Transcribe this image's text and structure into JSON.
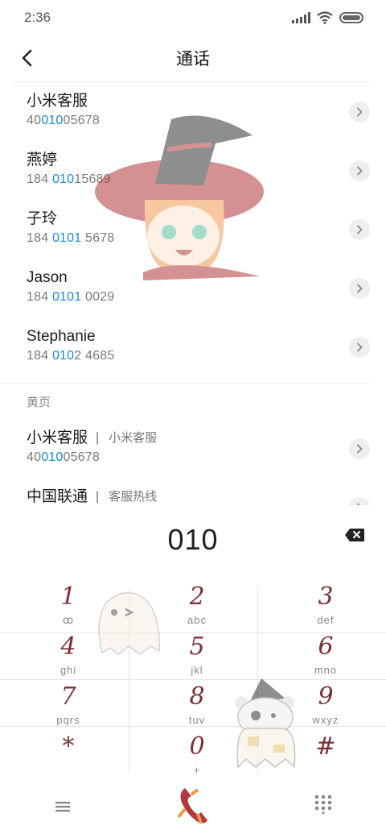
{
  "status_bar": {
    "time": "2:36"
  },
  "header": {
    "title": "通话"
  },
  "contacts": [
    {
      "name": "小米客服",
      "number_parts": [
        "40",
        "010",
        "05678"
      ]
    },
    {
      "name": "燕婷",
      "number_parts": [
        "184 ",
        "010",
        "15689"
      ]
    },
    {
      "name": "子玲",
      "number_parts": [
        "184 ",
        "0101",
        " 5678"
      ]
    },
    {
      "name": "Jason",
      "number_parts": [
        "184 ",
        "0101",
        " 0029"
      ]
    },
    {
      "name": "Stephanie",
      "number_parts": [
        "184 ",
        "010",
        "2 4685"
      ]
    }
  ],
  "yellow_pages": {
    "section_title": "黄页",
    "items": [
      {
        "name": "小米客服",
        "tag": "小米客服",
        "number_parts": [
          "40",
          "010",
          "05678"
        ]
      },
      {
        "name": "中国联通",
        "tag": "客服热线"
      }
    ]
  },
  "dialer": {
    "input": "010",
    "keys": [
      {
        "digit": "1",
        "letters": "ꝏ"
      },
      {
        "digit": "2",
        "letters": "abc"
      },
      {
        "digit": "3",
        "letters": "def"
      },
      {
        "digit": "4",
        "letters": "ghi"
      },
      {
        "digit": "5",
        "letters": "jkl"
      },
      {
        "digit": "6",
        "letters": "mno"
      },
      {
        "digit": "7",
        "letters": "pqrs"
      },
      {
        "digit": "8",
        "letters": "tuv"
      },
      {
        "digit": "9",
        "letters": "wxyz"
      },
      {
        "digit": "*",
        "letters": ""
      },
      {
        "digit": "0",
        "letters": "+"
      },
      {
        "digit": "#",
        "letters": ""
      }
    ]
  },
  "bottom_bar": {
    "menu_icon": "menu-icon",
    "dial_icon": "dial-call-icon",
    "keypad_icon": "keypad-icon"
  },
  "colors": {
    "highlight": "#1a8ae0",
    "key_digit": "#7b3035",
    "chevron_bg": "#eeeeee"
  }
}
